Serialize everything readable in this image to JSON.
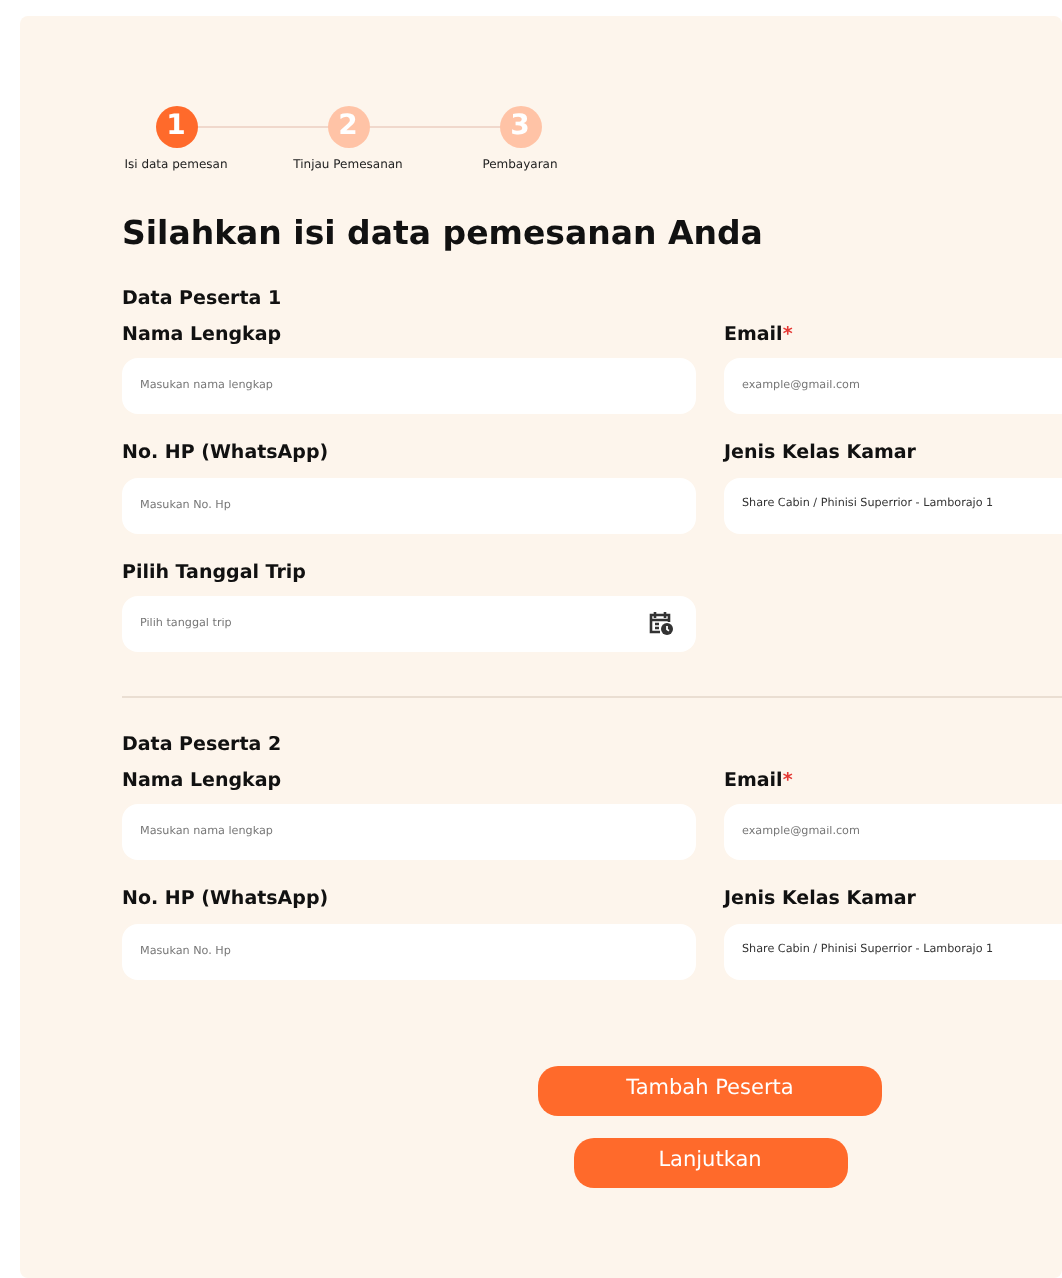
{
  "steps": [
    {
      "number": "1",
      "label": "Isi data pemesan",
      "selected": true
    },
    {
      "number": "2",
      "label": "Tinjau Pemesanan",
      "selected": false
    },
    {
      "number": "3",
      "label": "Pembayaran",
      "selected": false
    }
  ],
  "title": "Silahkan isi data pemesanan Anda",
  "sections": [
    {
      "heading": "Data Peserta 1",
      "fields": [
        {
          "kind": "text",
          "label": "Nama Lengkap",
          "placeholder": "Masukan nama lengkap"
        },
        {
          "kind": "text",
          "label": "Email",
          "required_mark": "*",
          "placeholder": "example@gmail.com"
        },
        {
          "kind": "text",
          "label": "No. HP (WhatsApp)",
          "placeholder": "Masukan No. Hp"
        },
        {
          "kind": "select",
          "label": "Jenis Kelas Kamar",
          "value": "Share Cabin / Phinisi Superrior - Lamborajo 1"
        },
        {
          "kind": "date",
          "label": "Pilih Tanggal Trip",
          "placeholder": "Pilih tanggal trip"
        }
      ]
    },
    {
      "heading": "Data Peserta 2",
      "fields": [
        {
          "kind": "text",
          "label": "Nama Lengkap",
          "placeholder": "Masukan nama lengkap"
        },
        {
          "kind": "text",
          "label": "Email",
          "required_mark": "*",
          "placeholder": "example@gmail.com"
        },
        {
          "kind": "text",
          "label": "No. HP (WhatsApp)",
          "placeholder": "Masukan No. Hp"
        },
        {
          "kind": "select",
          "label": "Jenis Kelas Kamar",
          "value": "Share Cabin / Phinisi Superrior - Lamborajo 1"
        }
      ]
    }
  ],
  "buttons": [
    "Tambah Peserta",
    "Lanjutkan"
  ]
}
